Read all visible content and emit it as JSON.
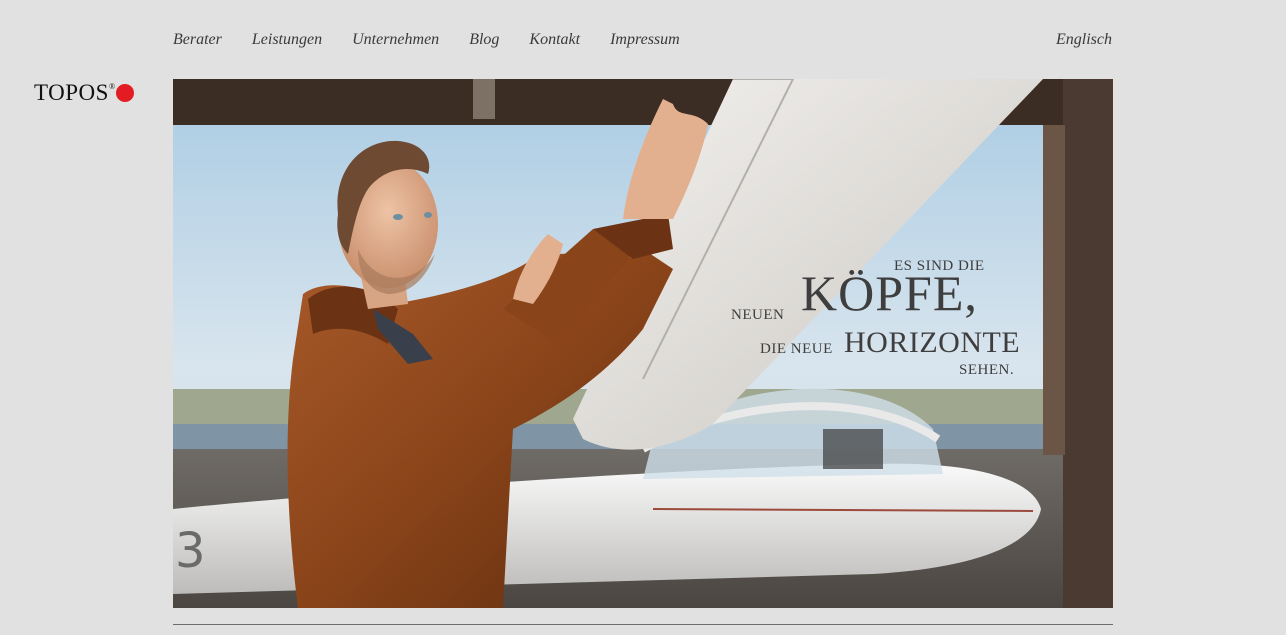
{
  "nav": {
    "items": [
      "Berater",
      "Leistungen",
      "Unternehmen",
      "Blog",
      "Kontakt",
      "Impressum"
    ],
    "language": "Englisch"
  },
  "logo": {
    "text": "TOPOS",
    "mark": "®"
  },
  "hero": {
    "tagline": {
      "line1": "ES SIND DIE",
      "line2_small": "NEUEN",
      "line2_big": "KÖPFE,",
      "line3_small": "DIE NEUE",
      "line3_big": "HORIZONTE",
      "line4": "SEHEN."
    },
    "plane_number": "3"
  },
  "colors": {
    "background": "#e1e1e1",
    "accent": "#e31b23",
    "text": "#3a3a3a"
  }
}
